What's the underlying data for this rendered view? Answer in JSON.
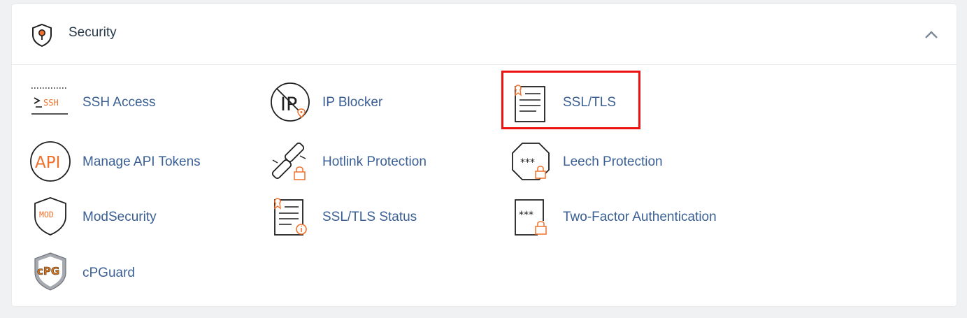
{
  "section": {
    "title": "Security",
    "icon": "shield-pin-icon",
    "collapse_icon": "chevron-up-icon"
  },
  "colors": {
    "link": "#3a5f94",
    "accent": "#f0702c",
    "icon_stroke": "#1f1f1f",
    "highlight": "#ee1111"
  },
  "items": [
    {
      "label": "SSH Access",
      "icon": "ssh-terminal-icon"
    },
    {
      "label": "IP Blocker",
      "icon": "ip-blocker-icon"
    },
    {
      "label": "SSL/TLS",
      "icon": "certificate-icon"
    },
    {
      "label": "Manage API Tokens",
      "icon": "api-icon"
    },
    {
      "label": "Hotlink Protection",
      "icon": "broken-link-lock-icon"
    },
    {
      "label": "Leech Protection",
      "icon": "password-lock-icon"
    },
    {
      "label": "ModSecurity",
      "icon": "mod-shield-icon"
    },
    {
      "label": "SSL/TLS Status",
      "icon": "certificate-info-icon"
    },
    {
      "label": "Two-Factor Authentication",
      "icon": "two-factor-icon"
    },
    {
      "label": "cPGuard",
      "icon": "cpguard-shield-icon"
    }
  ]
}
